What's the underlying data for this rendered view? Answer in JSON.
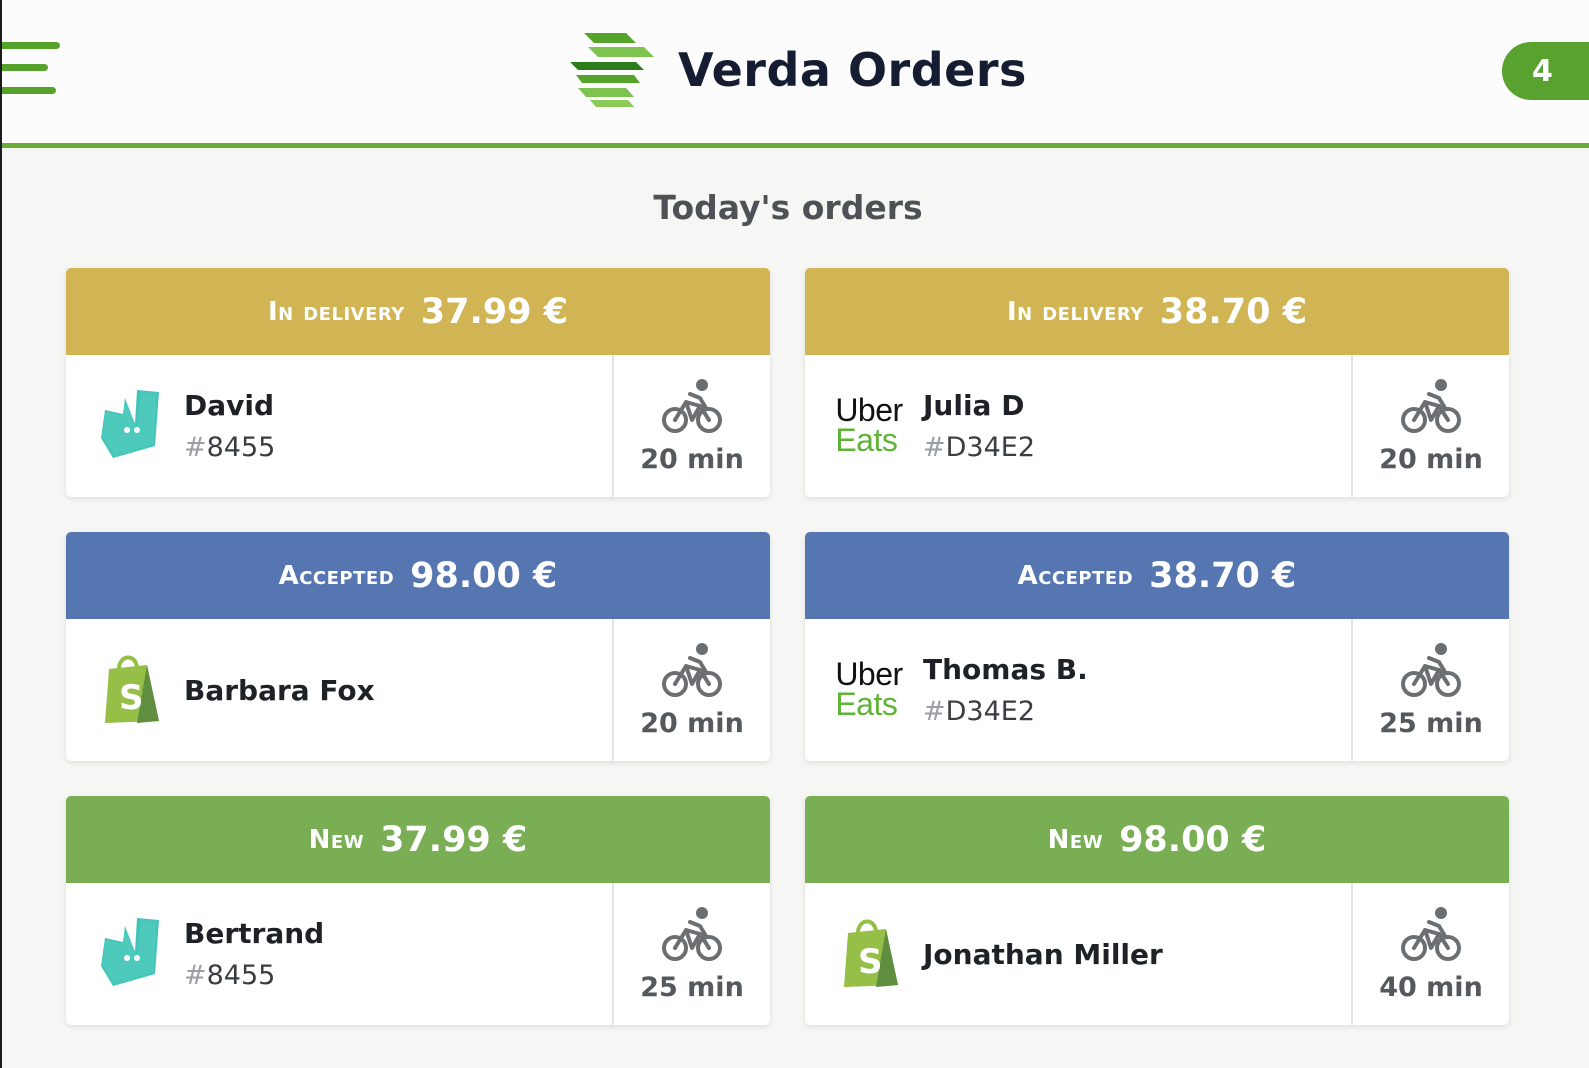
{
  "app": {
    "title": "Verda Orders",
    "notification_count": "4"
  },
  "page": {
    "title": "Today's orders"
  },
  "colors": {
    "in_delivery": "#d1b453",
    "accepted": "#5676b2",
    "new": "#7aae55",
    "accent": "#5aa22f"
  },
  "orders": [
    {
      "status": "IN DELIVERY",
      "price": "37.99 €",
      "platform": "deliveroo-icon",
      "customer": "David",
      "hash": "#",
      "id": "8455",
      "eta": "20 min"
    },
    {
      "status": "IN DELIVERY",
      "price": "38.70 €",
      "platform": "uber-eats-logo",
      "customer": "Julia D",
      "hash": "#",
      "id": "D34E2",
      "eta": "20 min"
    },
    {
      "status": "ACCEPTED",
      "price": "98.00 €",
      "platform": "shopify-icon",
      "customer": "Barbara Fox",
      "hash": "",
      "id": "",
      "eta": "20 min"
    },
    {
      "status": "ACCEPTED",
      "price": "38.70 €",
      "platform": "uber-eats-logo",
      "customer": "Thomas B.",
      "hash": "#",
      "id": "D34E2",
      "eta": "25 min"
    },
    {
      "status": "NEW",
      "price": "37.99 €",
      "platform": "deliveroo-icon",
      "customer": "Bertrand",
      "hash": "#",
      "id": "8455",
      "eta": "25 min"
    },
    {
      "status": "NEW",
      "price": "98.00 €",
      "platform": "shopify-icon",
      "customer": "Jonathan Miller",
      "hash": "",
      "id": "",
      "eta": "40 min"
    }
  ],
  "uber_logo": {
    "line1": "Uber",
    "line2": "Eats"
  }
}
